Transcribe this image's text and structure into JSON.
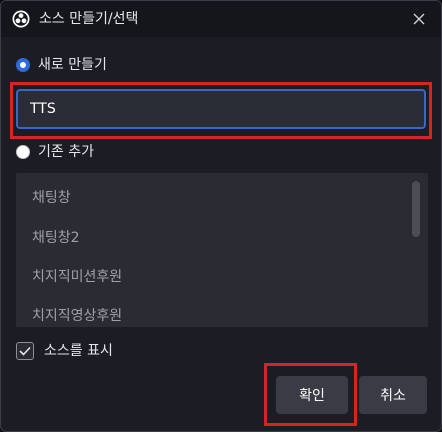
{
  "window": {
    "title": "소스 만들기/선택"
  },
  "options": {
    "create_new_label": "새로 만들기",
    "name_value": "TTS",
    "add_existing_label": "기존 추가"
  },
  "existing_sources": [
    "채팅창",
    "채팅창2",
    "치지직미션후원",
    "치지직영상후원"
  ],
  "show_source": {
    "label": "소스를 표시",
    "checked": true
  },
  "buttons": {
    "ok_label": "확인",
    "cancel_label": "취소"
  },
  "colors": {
    "highlight": "#d42525",
    "accent": "#3a66c9"
  }
}
